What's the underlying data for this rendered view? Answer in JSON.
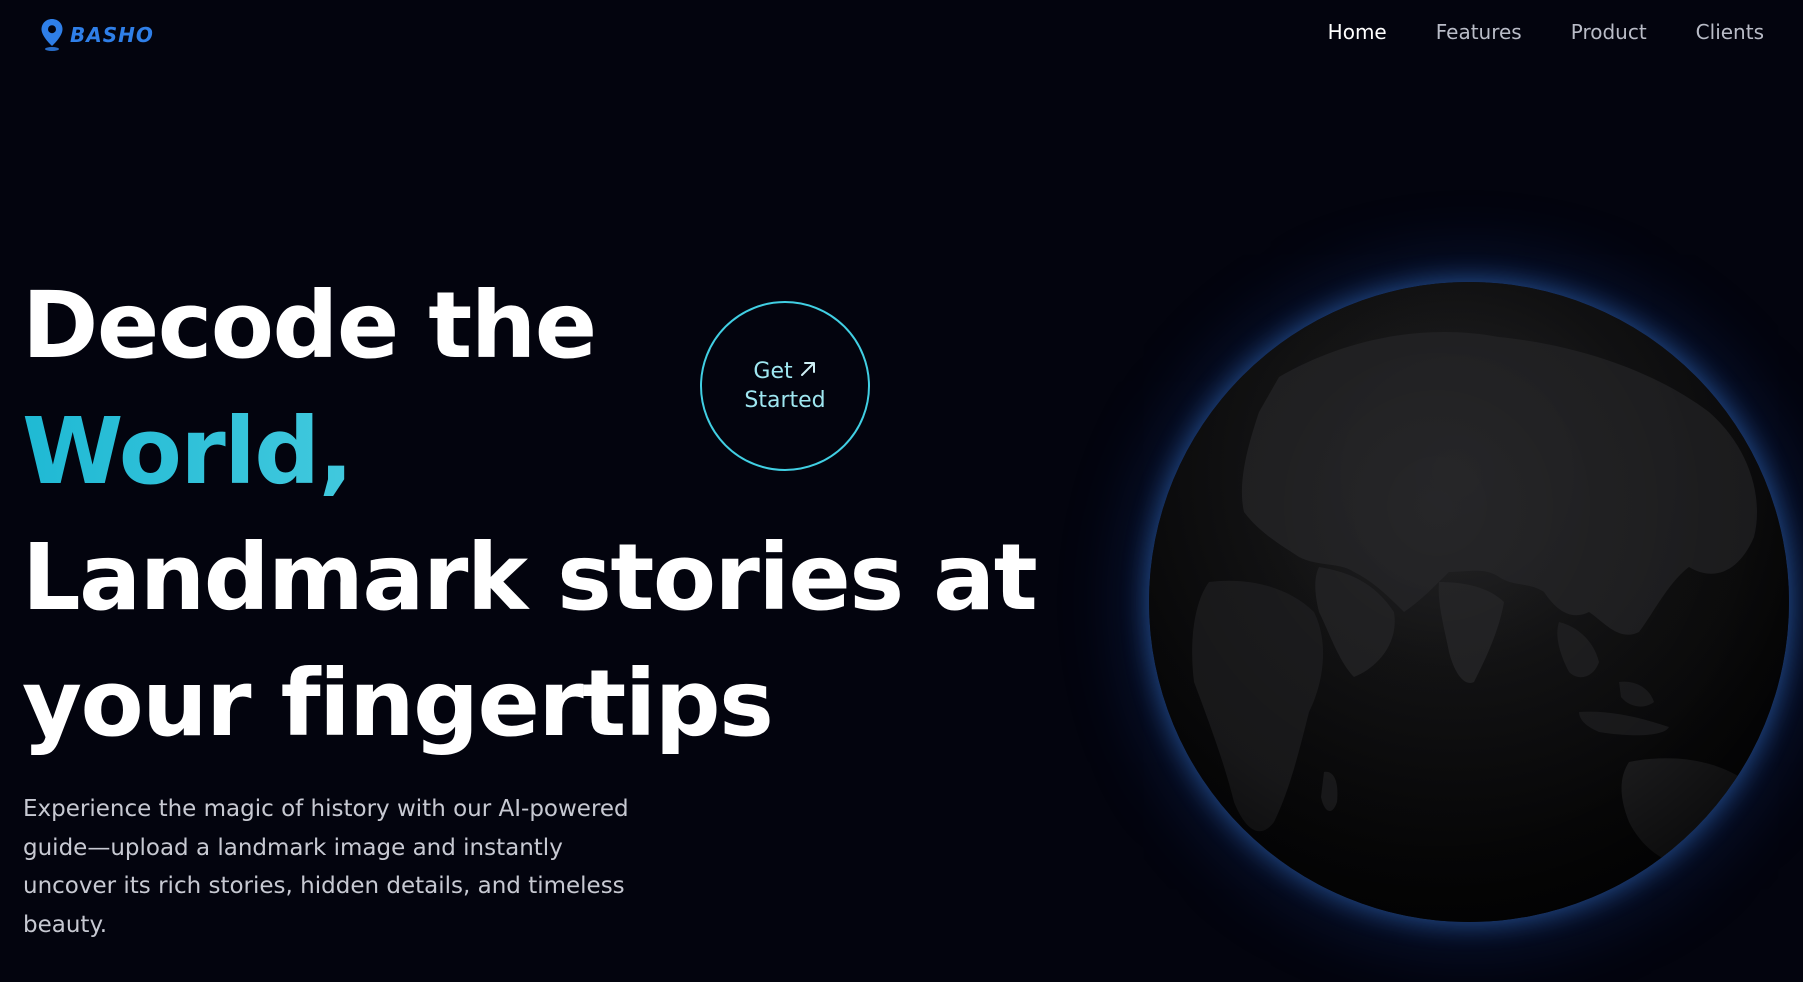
{
  "brand": {
    "name": "BASHO",
    "icon": "location-pin-icon",
    "color": "#2f7fe8"
  },
  "nav": {
    "items": [
      {
        "label": "Home",
        "active": true
      },
      {
        "label": "Features",
        "active": false
      },
      {
        "label": "Product",
        "active": false
      },
      {
        "label": "Clients",
        "active": false
      }
    ]
  },
  "hero": {
    "line1": "Decode the",
    "line2_accent": "World,",
    "line3": "Landmark stories at",
    "line4": "your fingertips",
    "accent_colors": [
      "#1fb9d4",
      "#a7ecf2"
    ],
    "description": "Experience the magic of history with our AI-powered guide—upload a landmark image and instantly uncover its rich stories, hidden details, and timeless beauty."
  },
  "cta": {
    "line1": "Get",
    "line2": "Started",
    "icon": "arrow-up-right-icon",
    "border_color": "#41cfe3"
  },
  "globe": {
    "icon": "earth-globe",
    "glow_color": "#3c82e6"
  }
}
